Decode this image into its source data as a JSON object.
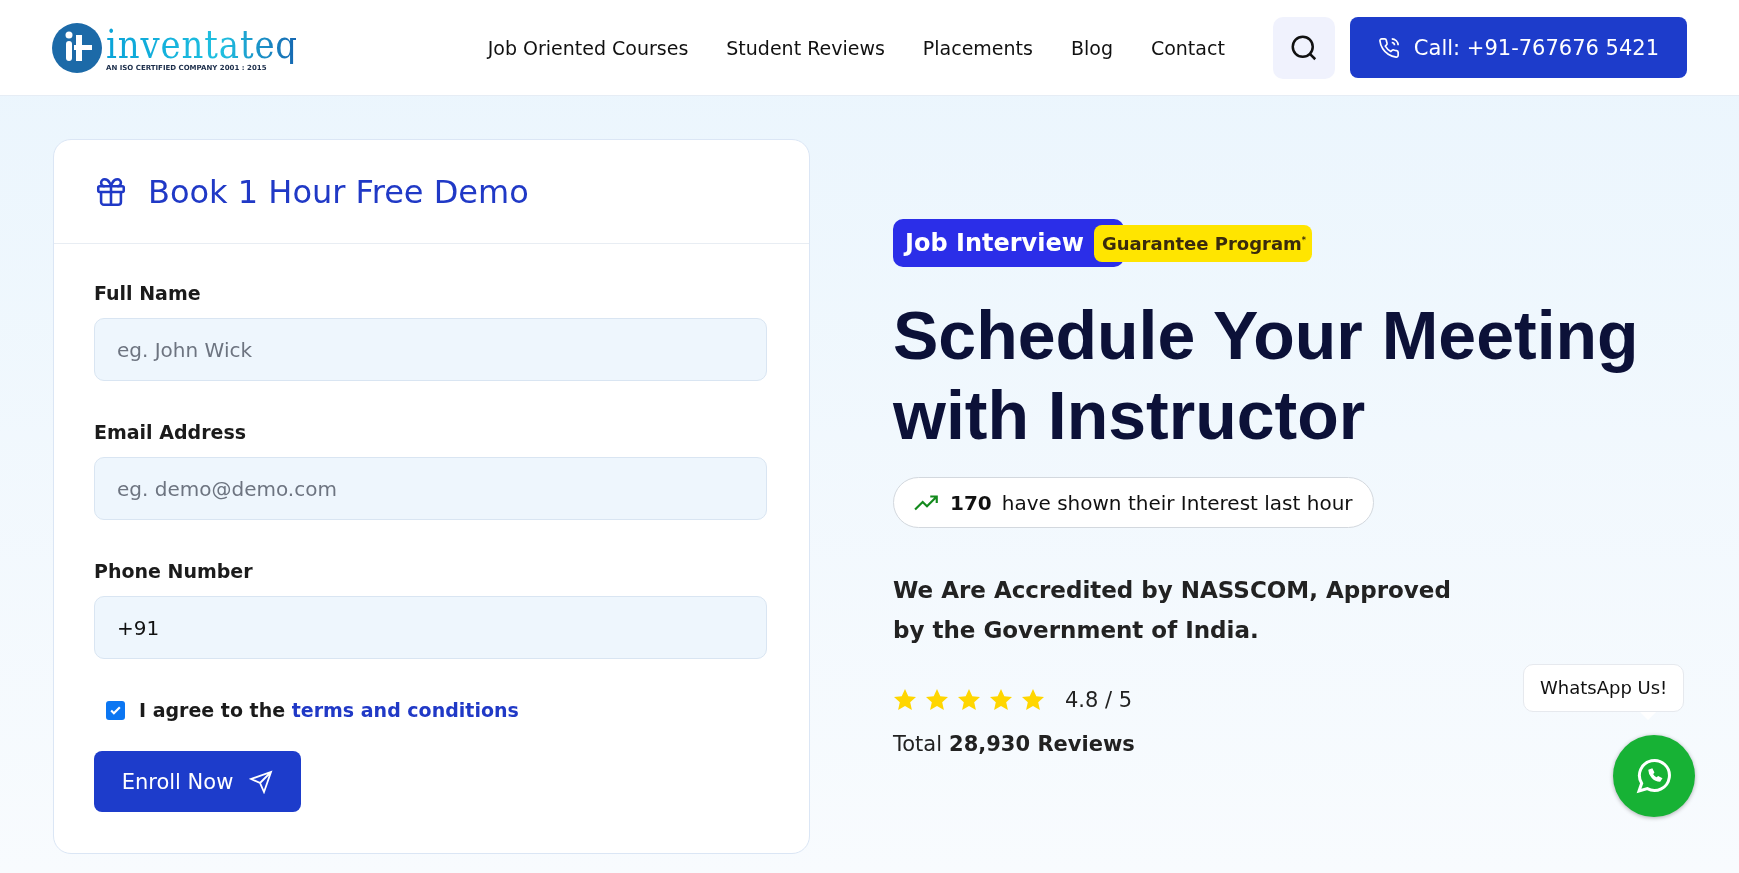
{
  "header": {
    "logo": {
      "name": "inventateq",
      "tagline": "AN ISO CERTIFIED COMPANY 2001 : 2015"
    },
    "nav": [
      {
        "label": "Job Oriented Courses"
      },
      {
        "label": "Student Reviews"
      },
      {
        "label": "Placements"
      },
      {
        "label": "Blog"
      },
      {
        "label": "Contact"
      }
    ],
    "call_button": "Call: +91-767676 5421"
  },
  "form": {
    "title": "Book 1 Hour Free Demo",
    "fields": [
      {
        "label": "Full Name",
        "placeholder": "eg. John Wick"
      },
      {
        "label": "Email Address",
        "placeholder": "eg. demo@demo.com"
      },
      {
        "label": "Phone Number",
        "value": "+91"
      }
    ],
    "agree": {
      "checked": true,
      "text": "I agree to the",
      "link": "terms and conditions"
    },
    "submit": "Enroll Now"
  },
  "hero": {
    "badge": {
      "primary": "Job Interview",
      "secondary": "Guarantee Program",
      "mark": "*"
    },
    "heading": "Schedule Your Meeting with Instructor",
    "interest": {
      "count": "170",
      "text": "have shown their Interest last hour"
    },
    "accreditation": "We Are Accredited by NASSCOM, Approved by the Government of India.",
    "rating": {
      "stars": 5,
      "score": "4.8 / 5",
      "total_prefix": "Total",
      "total": "28,930 Reviews"
    }
  },
  "whatsapp": {
    "tooltip": "WhatsApp Us!"
  }
}
